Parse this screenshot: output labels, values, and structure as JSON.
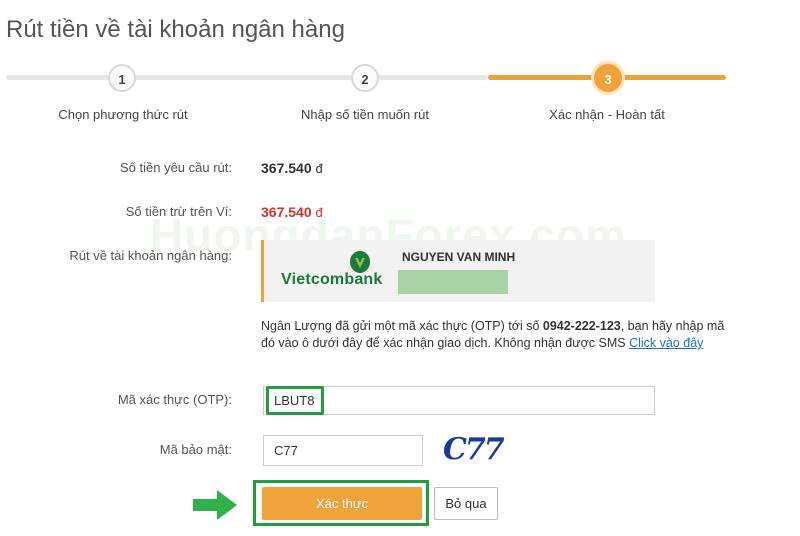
{
  "page": {
    "title": "Rút tiền về tài khoản ngân hàng"
  },
  "steps": [
    {
      "number": "1",
      "label": "Chọn phương thức rút"
    },
    {
      "number": "2",
      "label": "Nhập số tiền muốn rút"
    },
    {
      "number": "3",
      "label": "Xác nhận - Hoàn tất"
    }
  ],
  "summary": {
    "requested_label": "Số tiền yêu cầu rút:",
    "requested_value": "367.540",
    "deducted_label": "Số tiền trừ trên Ví:",
    "deducted_value": "367.540",
    "currency": "đ",
    "bank_label": "Rút về tài khoản ngân hàng:"
  },
  "bank": {
    "name": "Vietcombank",
    "account_holder": "NGUYEN VAN MINH"
  },
  "watermark": "HuongdanForex.com",
  "notice": {
    "prefix": "Ngân Lượng đã gửi một mã xác thực (OTP) tới số ",
    "phone": "0942-222-123",
    "suffix": ", bạn hãy nhập mã đó vào ô dưới đây để xác nhận giao dịch. Không nhận được SMS ",
    "link": "Click vào đây"
  },
  "form": {
    "otp_label": "Mã xác thực (OTP):",
    "otp_value": "LBUT8",
    "captcha_label": "Mã bảo mật:",
    "captcha_value": "C77",
    "captcha_image_text": "C77"
  },
  "actions": {
    "confirm_label": "Xác thực",
    "skip_label": "Bỏ qua"
  },
  "colors": {
    "accent": "#f0a33b",
    "highlight_green": "#1e9e3c",
    "amount_red": "#d32f2f",
    "link_blue": "#1a73c9"
  }
}
